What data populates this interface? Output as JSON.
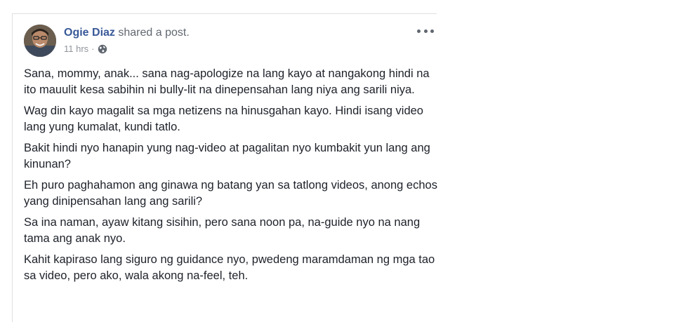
{
  "post": {
    "author": "Ogie Diaz",
    "action": "shared a post.",
    "time": "11 hrs",
    "separator": "·",
    "privacy_icon": "globe-icon",
    "more_icon": "more-options-icon",
    "paragraphs": [
      "Sana, mommy, anak... sana nag-apologize na lang kayo at nangakong hindi na ito mauulit kesa sabihin ni bully-lit na dinepensahan lang niya ang sarili niya.",
      "Wag din kayo magalit sa mga netizens na hinusgahan kayo. Hindi isang video lang yung kumalat, kundi tatlo.",
      "Bakit hindi nyo hanapin yung nag-video at pagalitan nyo kumbakit yun lang ang kinunan?",
      "Eh puro paghahamon ang ginawa ng batang yan sa tatlong videos, anong echos yang dinipensahan lang ang sarili?",
      "Sa ina naman, ayaw kitang sisihin, pero sana noon pa, na-guide nyo na nang tama ang anak nyo.",
      "Kahit kapiraso lang siguro ng guidance nyo, pwedeng maramdaman ng mga tao sa video, pero ako, wala akong na-feel, teh."
    ]
  },
  "colors": {
    "link": "#385898",
    "text": "#1d2129",
    "muted": "#90949c",
    "border": "#dddfe2"
  }
}
